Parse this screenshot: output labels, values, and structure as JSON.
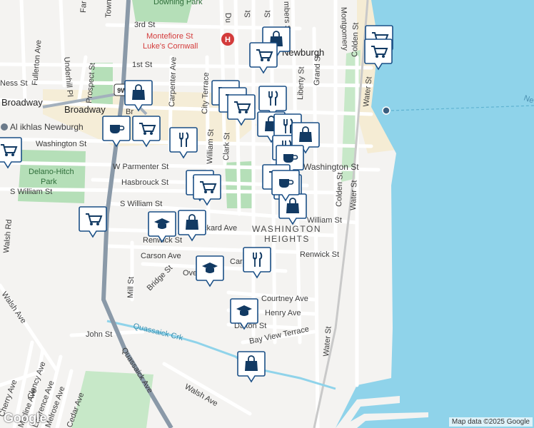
{
  "colors": {
    "water": "#8fd3ea",
    "land": "#f4f3f1",
    "park": "#b5dfb8",
    "road": "#ffffff",
    "road_edge": "#dcdcdc",
    "highway": "#8a99a8",
    "pin_fill": "#ffffff",
    "pin_border": "#1a4f86",
    "pin_icon": "#123a63",
    "hospital": "#d33b3b"
  },
  "streets": {
    "ness": "Ness St",
    "broadway": "Broadway",
    "broadway_2": "Broadway",
    "first": "1st St",
    "third": "3rd St",
    "washington_w": "Washington St",
    "washington_e": "Washington St",
    "w_parmenter": "W Parmenter St",
    "hasbrouck": "Hasbrouck St",
    "s_william_w": "S William St",
    "s_william": "S William St",
    "william_e": "William St",
    "renwick": "Renwick St",
    "renwick_e": "Renwick St",
    "carson": "Carson Ave",
    "carson_2": "Cars",
    "courtney": "Courtney Ave",
    "henry": "Henry Ave",
    "dalton": "Dalton St",
    "bay_view": "Bay View Terrace",
    "john": "John St",
    "walsh": "Walsh Ave",
    "walsh_rd": "Walsh Rd",
    "walsh_ave_w": "Walsh Ave",
    "overlook": "Ove",
    "packard": "ckard Ave",
    "fullerton": "Fullerton Ave",
    "underhill": "Underhill Pl",
    "prospect": "Prospect St",
    "carpenter": "Carpenter Ave",
    "city_terrace": "City Terrace",
    "william": "William St",
    "clark": "Clark St",
    "liberty": "Liberty St",
    "grand": "Grand St",
    "colden": "Colden St",
    "colden_2": "Colden St",
    "water": "Water St",
    "water_2": "Water St",
    "water_3": "Water St",
    "montgomery": "Montgomery",
    "mill": "Mill St",
    "bridge": "Bridge St",
    "quassaick_ave": "Quassaick Ave",
    "quassaick_crk": "Quassaick Crk",
    "cherry": "Cherry Ave",
    "clancy": "Clancy Ave",
    "merline": "Merline Ave",
    "lawrence": "Lawrence Ave",
    "melrose": "Melrose Ave",
    "cedar": "Cedar Ave",
    "town": "Town",
    "du": "Du",
    "st": "St",
    "st2": "St",
    "chambers": "mbers St",
    "far": "Far",
    "br": "Br"
  },
  "places": {
    "hospital_line1": "Montefiore St",
    "hospital_line2": "Luke's Cornwall",
    "downing_park": "Downing Park",
    "delano_line1": "Delano-Hitch",
    "delano_line2": "Park",
    "al_ikhlas": "Al ikhlas Newburgh",
    "newburgh": "Newburgh",
    "wash_heights_1": "WASHINGTON",
    "wash_heights_2": "HEIGHTS",
    "route_9w": "9W",
    "ne": "Ne"
  },
  "pins": [
    {
      "name": "shopping-bag-icon",
      "kind": "bag"
    },
    {
      "name": "shopping-cart-icon",
      "kind": "cart"
    },
    {
      "name": "shopping-cart-icon",
      "kind": "cart"
    },
    {
      "name": "shopping-cart-icon",
      "kind": "cart"
    },
    {
      "name": "shopping-cart-icon",
      "kind": "cart"
    },
    {
      "name": "shopping-bag-icon",
      "kind": "bag"
    },
    {
      "name": "cafe-icon",
      "kind": "cafe"
    },
    {
      "name": "shopping-cart-icon",
      "kind": "cart"
    },
    {
      "name": "restaurant-icon",
      "kind": "fork"
    },
    {
      "name": "shopping-cart-icon",
      "kind": "cart"
    },
    {
      "name": "shopping-cart-icon",
      "kind": "cart"
    },
    {
      "name": "shopping-cart-icon",
      "kind": "cart"
    },
    {
      "name": "restaurant-icon",
      "kind": "fork"
    },
    {
      "name": "shopping-bag-icon",
      "kind": "bag"
    },
    {
      "name": "restaurant-icon",
      "kind": "fork"
    },
    {
      "name": "restaurant-icon",
      "kind": "fork"
    },
    {
      "name": "shopping-bag-icon",
      "kind": "bag"
    },
    {
      "name": "cafe-icon",
      "kind": "cafe"
    },
    {
      "name": "shopping-cart-icon",
      "kind": "cart"
    },
    {
      "name": "shopping-cart-icon",
      "kind": "cart"
    },
    {
      "name": "shopping-bag-icon",
      "kind": "bag"
    },
    {
      "name": "school-icon",
      "kind": "school"
    },
    {
      "name": "shopping-bag-icon",
      "kind": "bag"
    },
    {
      "name": "shopping-cart-icon",
      "kind": "cart"
    },
    {
      "name": "restaurant-icon",
      "kind": "fork"
    },
    {
      "name": "school-icon",
      "kind": "school"
    },
    {
      "name": "school-icon",
      "kind": "school"
    },
    {
      "name": "shopping-bag-icon",
      "kind": "bag"
    },
    {
      "name": "cafe-icon",
      "kind": "cafe"
    },
    {
      "name": "shopping-cart-icon",
      "kind": "cart"
    },
    {
      "name": "shopping-cart-icon",
      "kind": "cart"
    }
  ],
  "attribution": "Map data ©2025 Google",
  "logo": "Google"
}
